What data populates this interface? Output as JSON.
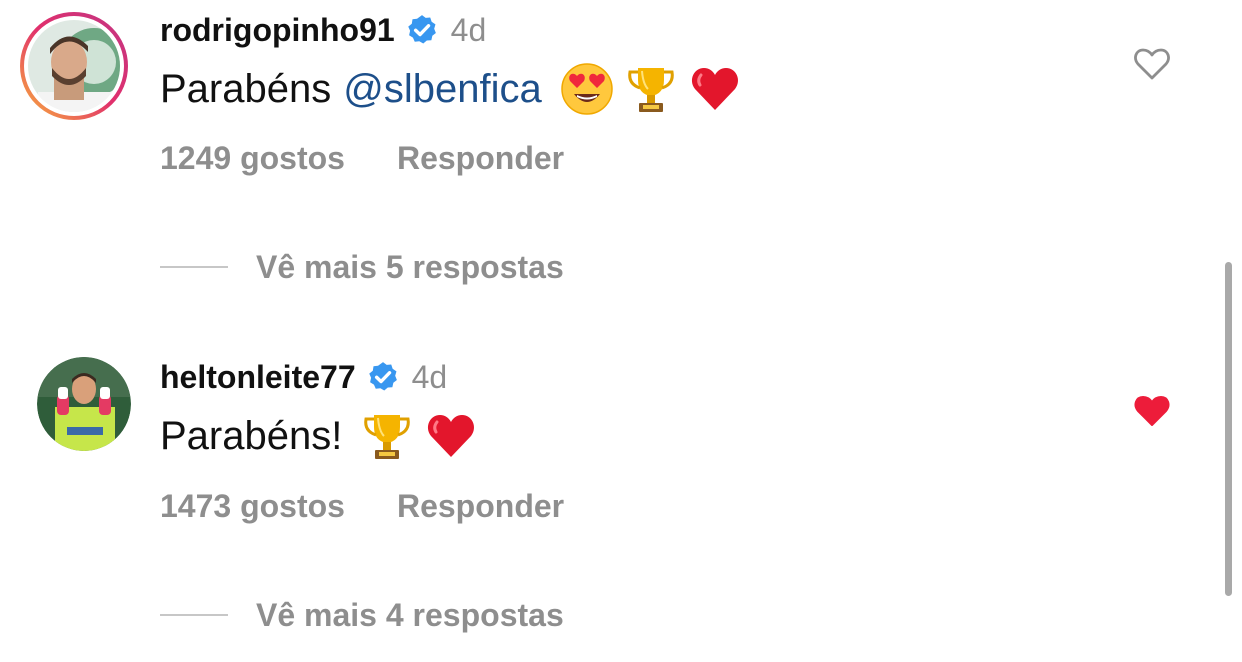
{
  "comments": [
    {
      "username": "rodrigopinho91",
      "verified": true,
      "time": "4d",
      "text": "Parabéns",
      "mention": "@slbenfica",
      "emojis": [
        "heart-eyes-emoji",
        "trophy-emoji",
        "red-heart-emoji"
      ],
      "likes": "1249 gostos",
      "reply_label": "Responder",
      "more_replies": "Vê mais 5 respostas",
      "liked": false,
      "avatar_ring": true
    },
    {
      "username": "heltonleite77",
      "verified": true,
      "time": "4d",
      "text": "Parabéns!",
      "emojis": [
        "trophy-emoji",
        "red-heart-emoji"
      ],
      "likes": "1473 gostos",
      "reply_label": "Responder",
      "more_replies": "Vê mais 4 respostas",
      "liked": true,
      "avatar_ring": false
    }
  ],
  "colors": {
    "verified": "#3897f0",
    "liked_heart": "#ed1c3a",
    "mention": "#1d4f8a",
    "secondary_text": "#8e8e8e"
  }
}
